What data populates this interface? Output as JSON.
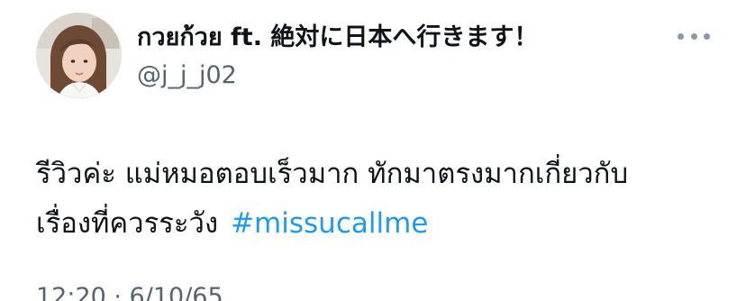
{
  "tweet": {
    "display_name": "กวยก้วย ft. 絶対に日本へ行きます！",
    "handle": "@j_j_j02",
    "more_icon": "more-horizontal-icon",
    "text_line1": "รีวิวค่ะ แม่หมอตอบเร็วมาก ทักมาตรงมากเกี่ยวกับ",
    "text_line2": "เรื่องที่ควรระวัง",
    "hashtag": "#missucallme",
    "timestamp": "12:20 · 6/10/65"
  },
  "colors": {
    "text": "#0f1419",
    "secondary": "#536471",
    "link": "#1d9bf0"
  }
}
